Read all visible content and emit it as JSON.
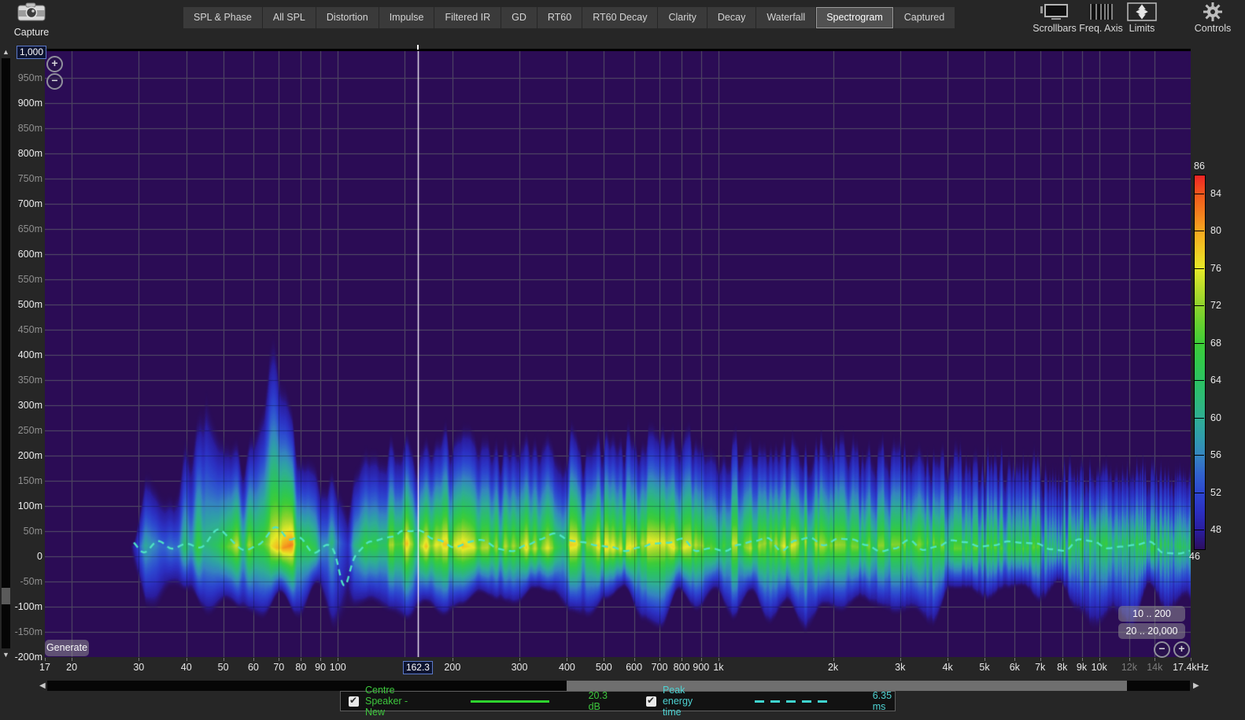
{
  "toolbar": {
    "capture_label": "Capture",
    "tabs": [
      {
        "label": "SPL & Phase",
        "active": false
      },
      {
        "label": "All SPL",
        "active": false
      },
      {
        "label": "Distortion",
        "active": false
      },
      {
        "label": "Impulse",
        "active": false
      },
      {
        "label": "Filtered IR",
        "active": false
      },
      {
        "label": "GD",
        "active": false
      },
      {
        "label": "RT60",
        "active": false
      },
      {
        "label": "RT60 Decay",
        "active": false
      },
      {
        "label": "Clarity",
        "active": false
      },
      {
        "label": "Decay",
        "active": false
      },
      {
        "label": "Waterfall",
        "active": false
      },
      {
        "label": "Spectrogram",
        "active": true
      },
      {
        "label": "Captured",
        "active": false
      }
    ],
    "right_tools": [
      {
        "label": "Scrollbars",
        "icon": "scrollbars-icon"
      },
      {
        "label": "Freq. Axis",
        "icon": "freq-axis-icon"
      },
      {
        "label": "Limits",
        "icon": "limits-icon"
      },
      {
        "label": "Controls",
        "icon": "gear-icon"
      }
    ]
  },
  "y_axis": {
    "edit_value": "1,000",
    "labels": [
      {
        "t": 950,
        "label": "950m"
      },
      {
        "t": 900,
        "label": "900m"
      },
      {
        "t": 850,
        "label": "850m"
      },
      {
        "t": 800,
        "label": "800m"
      },
      {
        "t": 750,
        "label": "750m"
      },
      {
        "t": 700,
        "label": "700m"
      },
      {
        "t": 650,
        "label": "650m"
      },
      {
        "t": 600,
        "label": "600m"
      },
      {
        "t": 550,
        "label": "550m"
      },
      {
        "t": 500,
        "label": "500m"
      },
      {
        "t": 450,
        "label": "450m"
      },
      {
        "t": 400,
        "label": "400m"
      },
      {
        "t": 350,
        "label": "350m"
      },
      {
        "t": 300,
        "label": "300m"
      },
      {
        "t": 250,
        "label": "250m"
      },
      {
        "t": 200,
        "label": "200m"
      },
      {
        "t": 150,
        "label": "150m"
      },
      {
        "t": 100,
        "label": "100m"
      },
      {
        "t": 50,
        "label": "50m"
      },
      {
        "t": 0,
        "label": "0"
      },
      {
        "t": -50,
        "label": "-50m"
      },
      {
        "t": -100,
        "label": "-100m"
      },
      {
        "t": -150,
        "label": "-150m"
      },
      {
        "t": -200,
        "label": "-200m"
      }
    ]
  },
  "x_axis": {
    "cursor_readout": "162.3",
    "labels": [
      {
        "hz": 17,
        "label": "17",
        "dim": false
      },
      {
        "hz": 20,
        "label": "20",
        "dim": false
      },
      {
        "hz": 30,
        "label": "30",
        "dim": false
      },
      {
        "hz": 40,
        "label": "40",
        "dim": false
      },
      {
        "hz": 50,
        "label": "50",
        "dim": false
      },
      {
        "hz": 60,
        "label": "60",
        "dim": false
      },
      {
        "hz": 70,
        "label": "70",
        "dim": false
      },
      {
        "hz": 80,
        "label": "80",
        "dim": false
      },
      {
        "hz": 90,
        "label": "90",
        "dim": false
      },
      {
        "hz": 100,
        "label": "100",
        "dim": false
      },
      {
        "hz": 200,
        "label": "200",
        "dim": false
      },
      {
        "hz": 300,
        "label": "300",
        "dim": false
      },
      {
        "hz": 400,
        "label": "400",
        "dim": false
      },
      {
        "hz": 500,
        "label": "500",
        "dim": false
      },
      {
        "hz": 600,
        "label": "600",
        "dim": false
      },
      {
        "hz": 700,
        "label": "700",
        "dim": false
      },
      {
        "hz": 800,
        "label": "800",
        "dim": false
      },
      {
        "hz": 900,
        "label": "900",
        "dim": false
      },
      {
        "hz": 1000,
        "label": "1k",
        "dim": false
      },
      {
        "hz": 2000,
        "label": "2k",
        "dim": false
      },
      {
        "hz": 3000,
        "label": "3k",
        "dim": false
      },
      {
        "hz": 4000,
        "label": "4k",
        "dim": false
      },
      {
        "hz": 5000,
        "label": "5k",
        "dim": false
      },
      {
        "hz": 6000,
        "label": "6k",
        "dim": false
      },
      {
        "hz": 7000,
        "label": "7k",
        "dim": false
      },
      {
        "hz": 8000,
        "label": "8k",
        "dim": false
      },
      {
        "hz": 9000,
        "label": "9k",
        "dim": false
      },
      {
        "hz": 10000,
        "label": "10k",
        "dim": false
      },
      {
        "hz": 12000,
        "label": "12k",
        "dim": true
      },
      {
        "hz": 14000,
        "label": "14k",
        "dim": true
      },
      {
        "hz": 17400,
        "label": "17.4kHz",
        "dim": false
      }
    ]
  },
  "plot_buttons": {
    "generate": "Generate",
    "zoom_in": "+",
    "zoom_out": "−",
    "range_time": "10 .. 200",
    "range_freq": "20 .. 20,000"
  },
  "legend": {
    "items": [
      {
        "label": "Centre Speaker - New",
        "value": "20.3 dB",
        "color": "#3dc73d",
        "line_color": "#2ed52e",
        "style": "solid",
        "checked": true
      },
      {
        "label": "Peak energy time",
        "value": "6.35 ms",
        "color": "#4ed3d3",
        "line_color": "#3fd4cf",
        "style": "dashed",
        "checked": true
      }
    ]
  },
  "chart_data": {
    "type": "heatmap",
    "subtype": "spectrogram",
    "x_axis": {
      "scale": "log",
      "min_hz": 17,
      "max_hz": 17400
    },
    "time_axis": {
      "max_ms": 1000,
      "min_ms": -200,
      "tick_step_ms": 50
    },
    "cursor_hz": 162.3,
    "background": "#2b0c55",
    "grid_color": "#73737f",
    "gridlines_hz": [
      20,
      30,
      40,
      50,
      60,
      70,
      80,
      90,
      100,
      150,
      200,
      300,
      400,
      500,
      600,
      700,
      800,
      900,
      1000,
      2000,
      3000,
      4000,
      5000,
      6000,
      7000,
      8000,
      9000,
      10000,
      12000,
      14000
    ],
    "colorbar": {
      "min_db": 46,
      "max_db": 86,
      "top_label": "86",
      "bottom_label": "46",
      "ticks": [
        {
          "v": 84,
          "label": "84"
        },
        {
          "v": 80,
          "label": "80"
        },
        {
          "v": 76,
          "label": "76"
        },
        {
          "v": 72,
          "label": "72"
        },
        {
          "v": 68,
          "label": "68"
        },
        {
          "v": 64,
          "label": "64"
        },
        {
          "v": 60,
          "label": "60"
        },
        {
          "v": 56,
          "label": "56"
        },
        {
          "v": 52,
          "label": "52"
        },
        {
          "v": 48,
          "label": "48"
        }
      ],
      "stops": [
        [
          46,
          "#2c0e5e"
        ],
        [
          48,
          "#2a1d9e"
        ],
        [
          50,
          "#2b2fc0"
        ],
        [
          52,
          "#2c45cf"
        ],
        [
          54,
          "#3161cd"
        ],
        [
          56,
          "#3584c0"
        ],
        [
          58,
          "#2f9cab"
        ],
        [
          60,
          "#2fae94"
        ],
        [
          62,
          "#2db978"
        ],
        [
          64,
          "#2cc262"
        ],
        [
          66,
          "#31c94b"
        ],
        [
          68,
          "#3ecc38"
        ],
        [
          70,
          "#63d02f"
        ],
        [
          72,
          "#8ed32c"
        ],
        [
          74,
          "#b8dd2b"
        ],
        [
          76,
          "#e6ea28"
        ],
        [
          78,
          "#f0c922"
        ],
        [
          80,
          "#f5a81f"
        ],
        [
          82,
          "#f37d1d"
        ],
        [
          84,
          "#f1571c"
        ],
        [
          86,
          "#ee2525"
        ]
      ]
    },
    "envelope_f_top_ms_core_db": [
      [
        28,
        60,
        50
      ],
      [
        30,
        150,
        58
      ],
      [
        32,
        195,
        62
      ],
      [
        34,
        170,
        60
      ],
      [
        37,
        150,
        60
      ],
      [
        40,
        260,
        66
      ],
      [
        43,
        300,
        70
      ],
      [
        45,
        430,
        73
      ],
      [
        47,
        360,
        75
      ],
      [
        49,
        300,
        76
      ],
      [
        52,
        235,
        73
      ],
      [
        55,
        235,
        76
      ],
      [
        58,
        230,
        73
      ],
      [
        61,
        290,
        73
      ],
      [
        64,
        340,
        74
      ],
      [
        66,
        430,
        76
      ],
      [
        69,
        400,
        79
      ],
      [
        72,
        330,
        81
      ],
      [
        75,
        300,
        82
      ],
      [
        78,
        260,
        80
      ],
      [
        82,
        235,
        75
      ],
      [
        87,
        215,
        71
      ],
      [
        92,
        200,
        67
      ],
      [
        97,
        180,
        62
      ],
      [
        102,
        150,
        55
      ],
      [
        106,
        120,
        51
      ],
      [
        110,
        170,
        60
      ],
      [
        115,
        210,
        66
      ],
      [
        122,
        245,
        72
      ],
      [
        130,
        255,
        75
      ],
      [
        138,
        235,
        73
      ],
      [
        147,
        250,
        78
      ],
      [
        157,
        260,
        82
      ],
      [
        167,
        255,
        83
      ],
      [
        178,
        250,
        80
      ],
      [
        190,
        258,
        78
      ],
      [
        205,
        265,
        80
      ],
      [
        220,
        252,
        77
      ],
      [
        240,
        246,
        74
      ],
      [
        262,
        250,
        76
      ],
      [
        285,
        255,
        78
      ],
      [
        310,
        252,
        78
      ],
      [
        340,
        247,
        76
      ],
      [
        370,
        250,
        76
      ],
      [
        405,
        252,
        78
      ],
      [
        450,
        247,
        76
      ],
      [
        500,
        250,
        78
      ],
      [
        560,
        246,
        76
      ],
      [
        620,
        250,
        78
      ],
      [
        690,
        246,
        76
      ],
      [
        760,
        250,
        77
      ],
      [
        840,
        247,
        76
      ],
      [
        930,
        250,
        76
      ],
      [
        1030,
        248,
        76
      ],
      [
        1150,
        244,
        74
      ],
      [
        1300,
        240,
        75
      ],
      [
        1500,
        238,
        76
      ],
      [
        1750,
        236,
        74
      ],
      [
        2000,
        234,
        73
      ],
      [
        2300,
        232,
        71
      ],
      [
        2700,
        230,
        72
      ],
      [
        3100,
        226,
        71
      ],
      [
        3600,
        222,
        72
      ],
      [
        4200,
        218,
        70
      ],
      [
        4900,
        214,
        70
      ],
      [
        5700,
        212,
        69
      ],
      [
        6600,
        210,
        70
      ],
      [
        7600,
        208,
        68
      ],
      [
        8800,
        206,
        69
      ],
      [
        10000,
        205,
        68
      ],
      [
        11500,
        202,
        67
      ],
      [
        13000,
        200,
        68
      ],
      [
        15000,
        198,
        67
      ],
      [
        17400,
        196,
        66
      ]
    ],
    "peak_energy_trace": {
      "label": "Peak energy time",
      "value_ms": 6.35,
      "base_ms": 20,
      "bumps_hz_amp": [
        [
          50,
          30
        ],
        [
          70,
          40
        ],
        [
          104,
          -78
        ],
        [
          160,
          45
        ],
        [
          230,
          15
        ],
        [
          370,
          10
        ]
      ]
    },
    "measurement": {
      "label": "Centre Speaker - New",
      "level_db": 20.3
    },
    "striation_seed": 7
  }
}
